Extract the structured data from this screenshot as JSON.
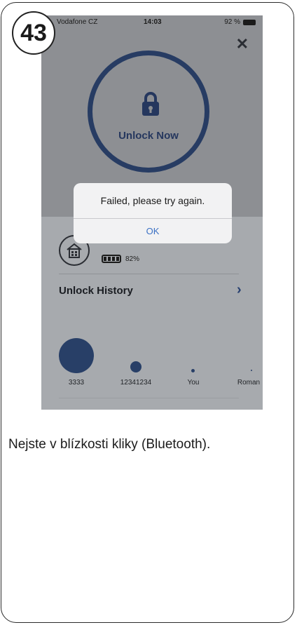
{
  "step_number": "43",
  "status_bar": {
    "carrier": "Vodafone CZ",
    "time": "14:03",
    "battery": "92 %"
  },
  "main": {
    "unlock_label": "Unlock Now",
    "close_icon": "close-icon"
  },
  "alert": {
    "message": "Failed, please try again.",
    "ok_label": "OK"
  },
  "lock_info": {
    "battery_percent": "82%"
  },
  "history": {
    "title": "Unlock History",
    "users": [
      {
        "name": "3333"
      },
      {
        "name": "12341234"
      },
      {
        "name": "You"
      },
      {
        "name": "Roman"
      }
    ]
  },
  "caption": "Nejste v blízkosti kliky (Bluetooth).",
  "colors": {
    "accent": "#273c63",
    "dialog_button": "#3b71c4"
  }
}
